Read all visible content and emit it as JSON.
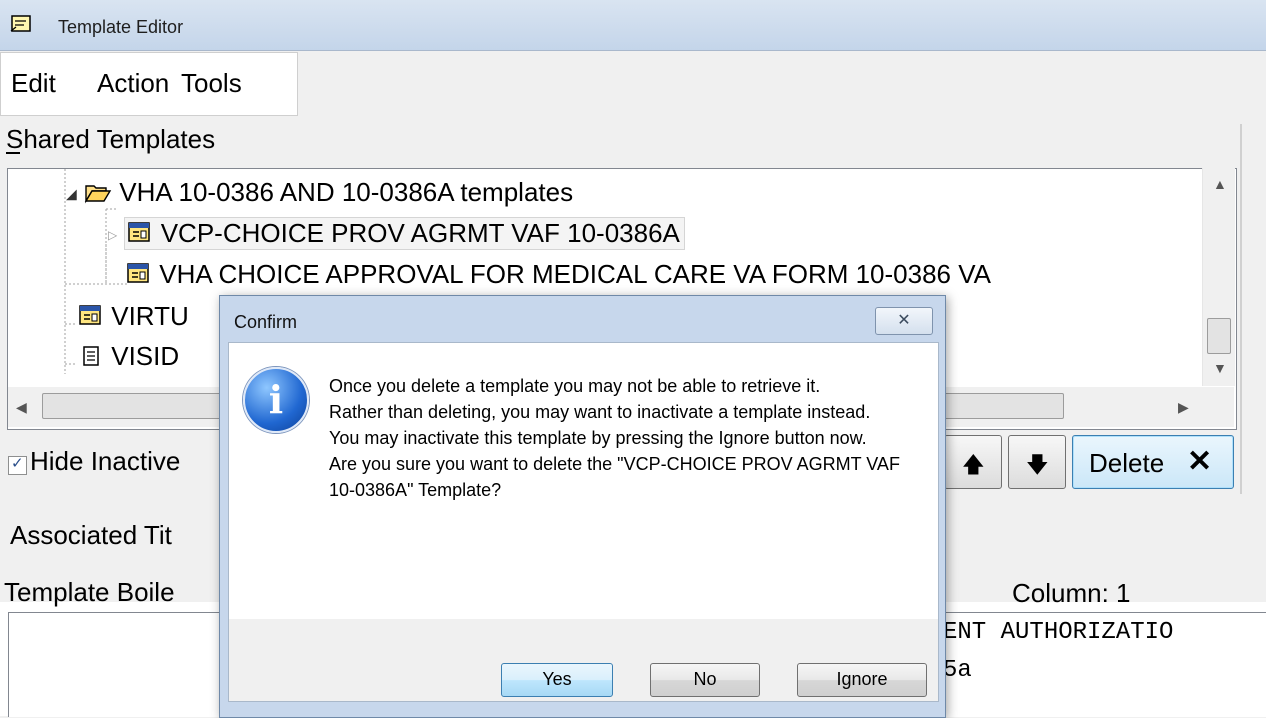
{
  "window": {
    "title": "Template Editor"
  },
  "menu": [
    "Edit",
    "Action",
    "Tools"
  ],
  "shared_templates": {
    "label": "Shared Templates",
    "tree": [
      {
        "label": "VHA 10-0386 AND 10-0386A templates",
        "icon": "folder-open-icon"
      },
      {
        "label": "VCP-CHOICE PROV AGRMT VAF 10-0386A",
        "icon": "dialog-template-icon",
        "selected": true
      },
      {
        "label": "VHA CHOICE APPROVAL FOR MEDICAL CARE VA FORM 10-0386 VA",
        "icon": "dialog-template-icon"
      },
      {
        "label": "VIRTU",
        "icon": "dialog-template-icon"
      },
      {
        "label": "VISID",
        "icon": "template-icon"
      }
    ]
  },
  "hide_inactive": {
    "label": "Hide Inactive",
    "checked": true
  },
  "buttons": {
    "delete": "Delete"
  },
  "lower": {
    "associated_title_label": "Associated Tit",
    "boilerplate_label": "Template Boile",
    "column_label": "Column: 1",
    "boilerplate_text": [
      "ENT AUTHORIZATIO",
      "5a"
    ]
  },
  "dialog": {
    "title": "Confirm",
    "message": "Once you delete a template you may not be able to retrieve it.\nRather than deleting, you may want to inactivate a template instead.\nYou may inactivate this template by pressing the Ignore button now.\nAre you sure you want to delete the \"VCP-CHOICE PROV AGRMT VAF 10-0386A\" Template?",
    "buttons": [
      "Yes",
      "No",
      "Ignore"
    ]
  }
}
